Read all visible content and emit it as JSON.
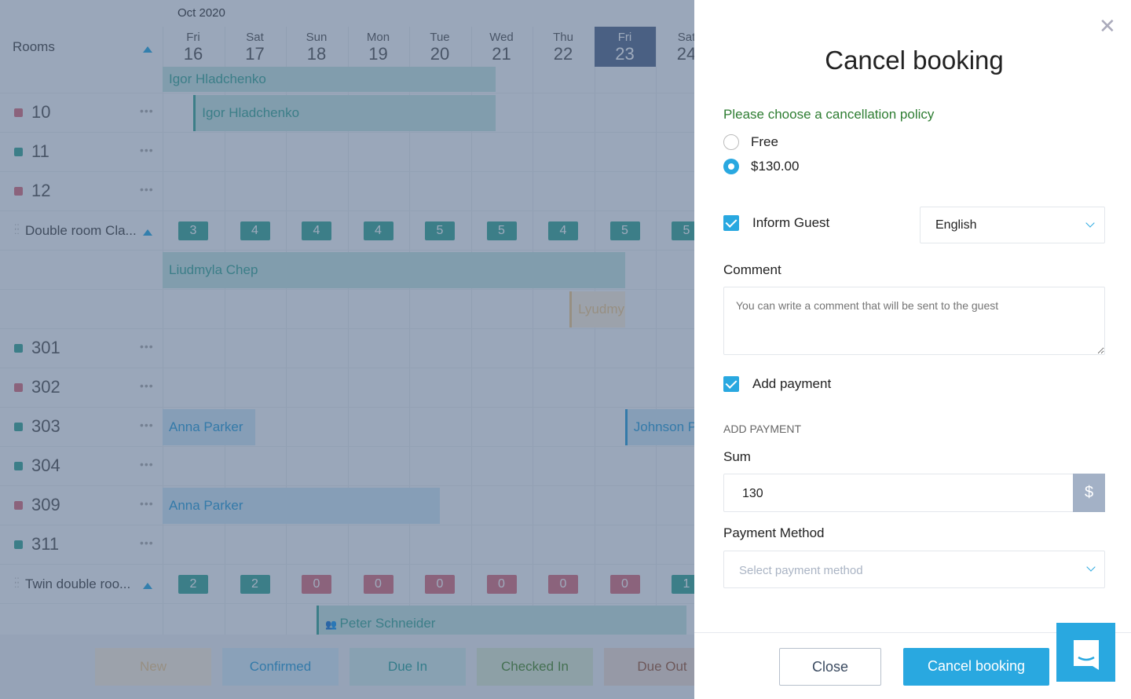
{
  "calendar": {
    "month": "Oct 2020",
    "rooms_header": "Rooms",
    "days": [
      {
        "name": "Fri",
        "date": "16"
      },
      {
        "name": "Sat",
        "date": "17"
      },
      {
        "name": "Sun",
        "date": "18"
      },
      {
        "name": "Mon",
        "date": "19"
      },
      {
        "name": "Tue",
        "date": "20"
      },
      {
        "name": "Wed",
        "date": "21"
      },
      {
        "name": "Thu",
        "date": "22"
      },
      {
        "name": "Fri",
        "date": "23",
        "today": true
      },
      {
        "name": "Sat",
        "date": "24"
      }
    ],
    "rooms": [
      {
        "type": "room",
        "label": "10",
        "status": "#d9707f"
      },
      {
        "type": "room",
        "label": "11",
        "status": "#3aa797"
      },
      {
        "type": "room",
        "label": "12",
        "status": "#d9707f"
      },
      {
        "type": "category",
        "label": "Double room Cla...",
        "counts": [
          "3",
          "4",
          "4",
          "4",
          "5",
          "5",
          "4",
          "5",
          "5"
        ]
      },
      {
        "type": "blank"
      },
      {
        "type": "blank"
      },
      {
        "type": "room",
        "label": "301",
        "status": "#3aa797"
      },
      {
        "type": "room",
        "label": "302",
        "status": "#d9707f"
      },
      {
        "type": "room",
        "label": "303",
        "status": "#3aa797"
      },
      {
        "type": "room",
        "label": "304",
        "status": "#3aa797"
      },
      {
        "type": "room",
        "label": "309",
        "status": "#d9707f"
      },
      {
        "type": "room",
        "label": "311",
        "status": "#3aa797"
      },
      {
        "type": "category",
        "label": "Twin double roo...",
        "counts": [
          "2",
          "2",
          "0",
          "0",
          "0",
          "0",
          "0",
          "0",
          "1"
        ]
      },
      {
        "type": "blank"
      }
    ],
    "bookings": [
      {
        "guest": "Igor Hladchenko",
        "row": -1,
        "start": 0,
        "end": 5.4,
        "color": "teal"
      },
      {
        "guest": "Igor Hladchenko",
        "row": 0,
        "start": 0.5,
        "end": 5.4,
        "color": "teal",
        "bar": true
      },
      {
        "guest": "Liudmyla Chep",
        "row": 4,
        "start": 0,
        "end": 7.5,
        "color": "teal"
      },
      {
        "guest": "Lyudmyla",
        "row": 5,
        "start": 6.6,
        "end": 7.5,
        "color": "orange",
        "bar": true
      },
      {
        "guest": "Anna Parker",
        "row": 8,
        "start": 0,
        "end": 1.5,
        "color": "blue"
      },
      {
        "guest": "Johnson P",
        "row": 8,
        "start": 7.5,
        "end": 9,
        "color": "blue",
        "bar": true
      },
      {
        "guest": "Anna Parker",
        "row": 10,
        "start": 0,
        "end": 4.5,
        "color": "blue"
      },
      {
        "guest": "Peter Schneider",
        "row": 13,
        "start": 2.5,
        "end": 8.5,
        "color": "teal",
        "bar": true,
        "icon": true
      }
    ],
    "legend": [
      {
        "label": "New",
        "color": "#f1c98a",
        "bg": "#fbeedd"
      },
      {
        "label": "Confirmed",
        "color": "#2a9fd8",
        "bg": "#d6ecf8"
      },
      {
        "label": "Due In",
        "color": "#2aa39a",
        "bg": "#d3ecea"
      },
      {
        "label": "Checked In",
        "color": "#4b8a2b",
        "bg": "#dcebd2"
      },
      {
        "label": "Due Out",
        "color": "#9c5a3a",
        "bg": "#efdcd3"
      }
    ]
  },
  "panel": {
    "title": "Cancel booking",
    "policy_heading": "Please choose a cancellation policy",
    "policy_options": [
      {
        "label": "Free",
        "selected": false
      },
      {
        "label": "$130.00",
        "selected": true
      }
    ],
    "inform_guest": {
      "label": "Inform Guest",
      "checked": true
    },
    "language": "English",
    "comment_label": "Comment",
    "comment_placeholder": "You can write a comment that will be sent to the guest",
    "add_payment": {
      "label": "Add payment",
      "checked": true
    },
    "add_payment_heading": "ADD PAYMENT",
    "sum_label": "Sum",
    "sum_value": "130",
    "currency": "$",
    "payment_method_label": "Payment Method",
    "payment_method_placeholder": "Select payment method",
    "close_label": "Close",
    "cancel_label": "Cancel booking"
  },
  "colors": {
    "accent": "#29a8e0",
    "policy_heading": "#2e7d32"
  }
}
